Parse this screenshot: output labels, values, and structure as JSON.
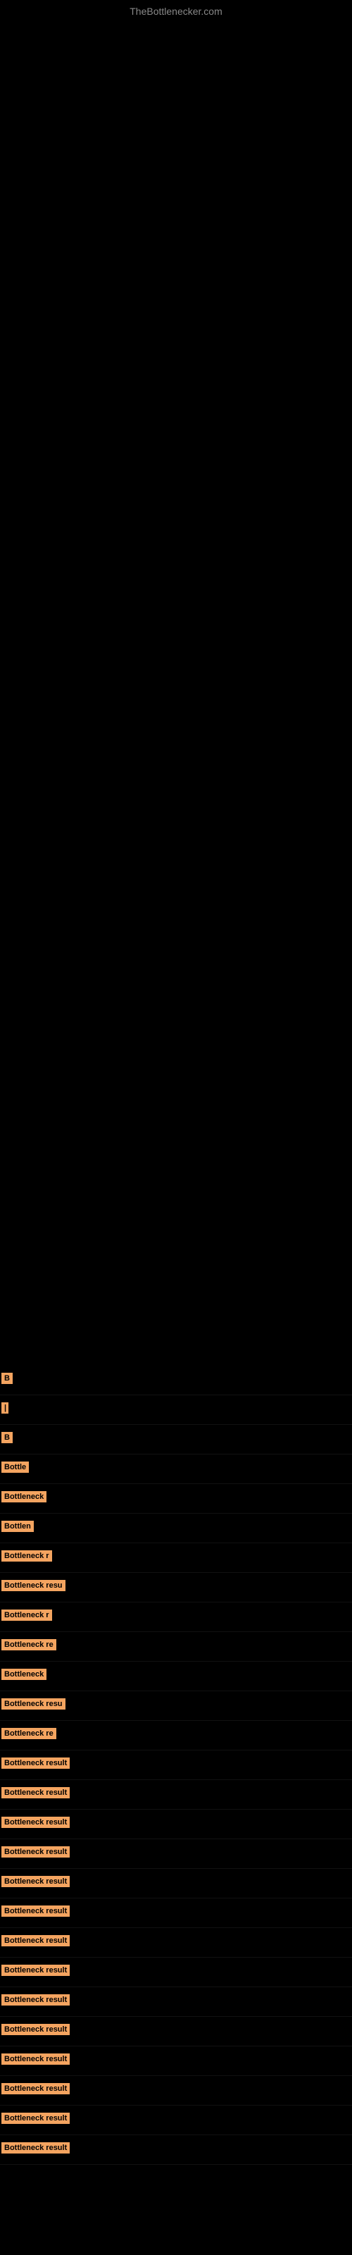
{
  "site": {
    "title": "TheBottlenecker.com"
  },
  "results": [
    {
      "id": 1,
      "label": "B",
      "width": 18
    },
    {
      "id": 2,
      "label": "|",
      "width": 10
    },
    {
      "id": 3,
      "label": "B",
      "width": 18
    },
    {
      "id": 4,
      "label": "Bottle",
      "width": 48
    },
    {
      "id": 5,
      "label": "Bottleneck",
      "width": 82
    },
    {
      "id": 6,
      "label": "Bottlen",
      "width": 62
    },
    {
      "id": 7,
      "label": "Bottleneck r",
      "width": 96
    },
    {
      "id": 8,
      "label": "Bottleneck resu",
      "width": 118
    },
    {
      "id": 9,
      "label": "Bottleneck r",
      "width": 96
    },
    {
      "id": 10,
      "label": "Bottleneck re",
      "width": 105
    },
    {
      "id": 11,
      "label": "Bottleneck",
      "width": 82
    },
    {
      "id": 12,
      "label": "Bottleneck resu",
      "width": 118
    },
    {
      "id": 13,
      "label": "Bottleneck re",
      "width": 105
    },
    {
      "id": 14,
      "label": "Bottleneck result",
      "width": 135
    },
    {
      "id": 15,
      "label": "Bottleneck result",
      "width": 135
    },
    {
      "id": 16,
      "label": "Bottleneck result",
      "width": 135
    },
    {
      "id": 17,
      "label": "Bottleneck result",
      "width": 135
    },
    {
      "id": 18,
      "label": "Bottleneck result",
      "width": 135
    },
    {
      "id": 19,
      "label": "Bottleneck result",
      "width": 135
    },
    {
      "id": 20,
      "label": "Bottleneck result",
      "width": 135
    },
    {
      "id": 21,
      "label": "Bottleneck result",
      "width": 135
    },
    {
      "id": 22,
      "label": "Bottleneck result",
      "width": 135
    },
    {
      "id": 23,
      "label": "Bottleneck result",
      "width": 135
    },
    {
      "id": 24,
      "label": "Bottleneck result",
      "width": 135
    },
    {
      "id": 25,
      "label": "Bottleneck result",
      "width": 135
    },
    {
      "id": 26,
      "label": "Bottleneck result",
      "width": 135
    },
    {
      "id": 27,
      "label": "Bottleneck result",
      "width": 135
    }
  ],
  "colors": {
    "background": "#000000",
    "label_bg": "#F4A460",
    "label_text": "#000000",
    "title_text": "#888888"
  }
}
